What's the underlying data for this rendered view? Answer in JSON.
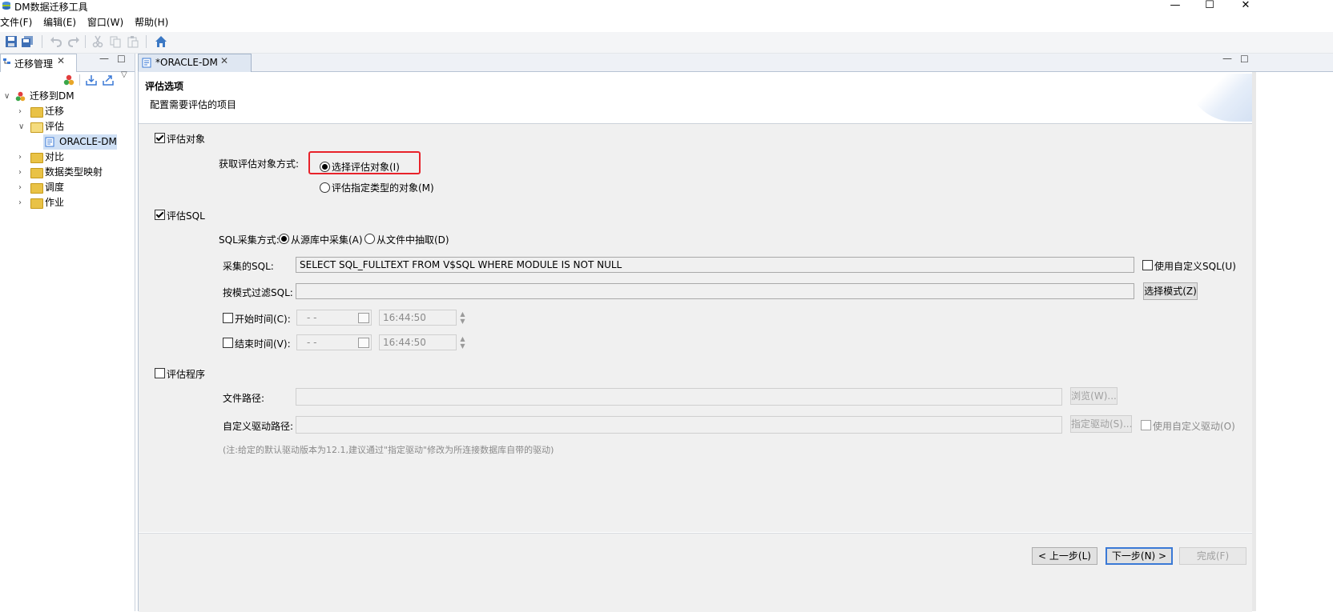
{
  "window": {
    "title": "DM数据迁移工具",
    "controls": {
      "minimize": "—",
      "maximize": "☐",
      "close": "✕"
    }
  },
  "menubar": [
    "文件(F)",
    "编辑(E)",
    "窗口(W)",
    "帮助(H)"
  ],
  "toolbar": {
    "icons": [
      "save-icon",
      "save-all-icon",
      "undo-icon",
      "redo-icon",
      "cut-icon",
      "copy-icon",
      "paste-icon",
      "home-icon"
    ]
  },
  "left_view": {
    "tab_label": "迁移管理",
    "tree": [
      {
        "label": "迁移到DM",
        "level": 0,
        "expanded": true,
        "icon": "dm-root-icon"
      },
      {
        "label": "迁移",
        "level": 1,
        "expanded": false,
        "icon": "folder-icon"
      },
      {
        "label": "评估",
        "level": 1,
        "expanded": true,
        "icon": "folder-open-icon"
      },
      {
        "label": "ORACLE-DM",
        "level": 2,
        "selected": true,
        "icon": "assessment-doc-icon"
      },
      {
        "label": "对比",
        "level": 1,
        "expanded": false,
        "icon": "folder-icon"
      },
      {
        "label": "数据类型映射",
        "level": 1,
        "expanded": false,
        "icon": "folder-icon"
      },
      {
        "label": "调度",
        "level": 1,
        "expanded": false,
        "icon": "folder-icon"
      },
      {
        "label": "作业",
        "level": 1,
        "expanded": false,
        "icon": "folder-icon"
      }
    ]
  },
  "editor": {
    "tab_label": "*ORACLE-DM",
    "header": {
      "title": "评估选项",
      "description": "配置需要评估的项目"
    },
    "eval_objects": {
      "checkbox_label": "评估对象",
      "checked": true,
      "method_label": "获取评估对象方式:",
      "option1": "选择评估对象(I)",
      "option2": "评估指定类型的对象(M)",
      "selected": 1
    },
    "eval_sql": {
      "checkbox_label": "评估SQL",
      "checked": true,
      "collect_label": "SQL采集方式:",
      "collect_option1": "从源库中采集(A)",
      "collect_option2": "从文件中抽取(D)",
      "collected_sql_label": "采集的SQL:",
      "collected_sql_value": "SELECT SQL_FULLTEXT FROM V$SQL WHERE MODULE IS NOT NULL",
      "custom_sql_label": "使用自定义SQL(U)",
      "filter_label": "按模式过滤SQL:",
      "filter_value": "",
      "select_schema_button": "选择模式(Z)",
      "start_time_label": "开始时间(C):",
      "start_date": "  -  -",
      "start_time": "16:44:50",
      "end_time_label": "结束时间(V):",
      "end_date": "  -  -",
      "end_time": "16:44:50"
    },
    "eval_program": {
      "checkbox_label": "评估程序",
      "checked": false,
      "file_path_label": "文件路径:",
      "browse_button": "浏览(W)...",
      "driver_path_label": "自定义驱动路径:",
      "driver_button": "指定驱动(S)...",
      "custom_driver_label": "使用自定义驱动(O)",
      "note": "(注:给定的默认驱动版本为12.1,建议通过\"指定驱动\"修改为所连接数据库自带的驱动)"
    },
    "footer": {
      "back_button": "< 上一步(L)",
      "next_button": "下一步(N) >",
      "finish_button": "完成(F)"
    }
  },
  "colors": {
    "highlight": "#e8222a",
    "focus": "#3a79d6",
    "folder": "#e9c246"
  }
}
